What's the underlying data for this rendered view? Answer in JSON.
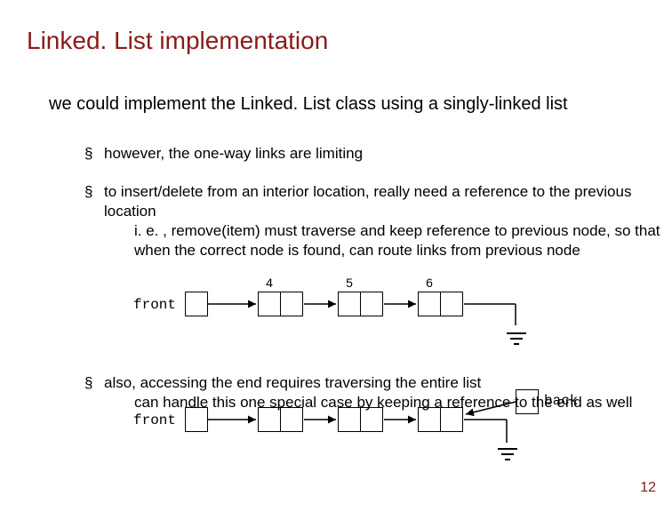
{
  "title": "Linked. List implementation",
  "intro": "we could implement the Linked. List class using a singly-linked list",
  "bullet1": "however, the one-way links are limiting",
  "bullet2_line1": "to insert/delete from an interior location, really need a reference to the previous location",
  "bullet2_sub1": "i. e. , remove(item) must traverse and keep reference to previous node, so that when the correct node is found, can route links from previous node",
  "bullet3_line1": "also, accessing the end requires traversing the entire list",
  "bullet3_sub1": "can handle this one special case by keeping a reference to the end as well",
  "diagram": {
    "front_label": "front",
    "back_label": "back",
    "values": [
      "4",
      "5",
      "6"
    ]
  },
  "page": "12"
}
